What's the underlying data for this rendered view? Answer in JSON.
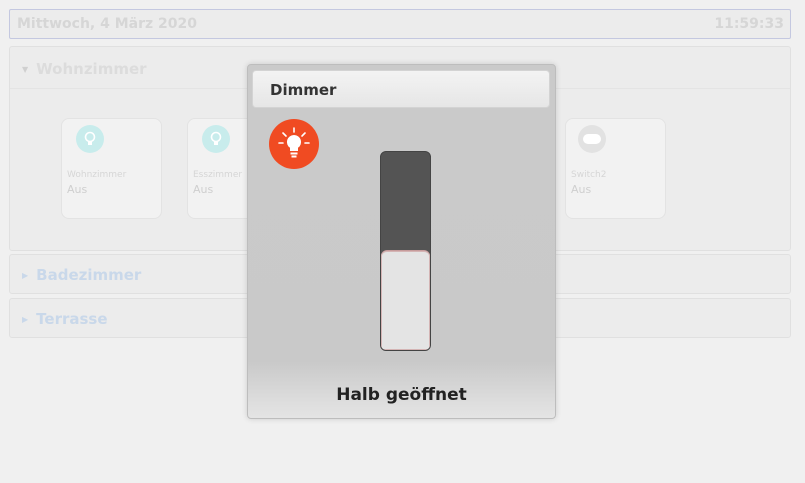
{
  "header": {
    "date": "Mittwoch, 4 März 2020",
    "time": "11:59:33"
  },
  "rooms": [
    {
      "name": "Wohnzimmer",
      "expanded": true
    },
    {
      "name": "Badezimmer",
      "expanded": false
    },
    {
      "name": "Terrasse",
      "expanded": false
    }
  ],
  "tiles": [
    {
      "name": "Wohnzimmer",
      "state": "Aus",
      "icon": "bulb-icon"
    },
    {
      "name": "Esszimmer",
      "state": "Aus",
      "icon": "bulb-icon"
    },
    {
      "name": "Switch2",
      "state": "Aus",
      "icon": "switch-icon"
    }
  ],
  "dialog": {
    "title": "Dimmer",
    "icon": "bulb-on-icon",
    "level": 0.5,
    "status": "Halb geöffnet"
  },
  "colors": {
    "accent": "#f04b22",
    "slider_track": "#545454",
    "slider_fill": "#e4e4e4"
  }
}
